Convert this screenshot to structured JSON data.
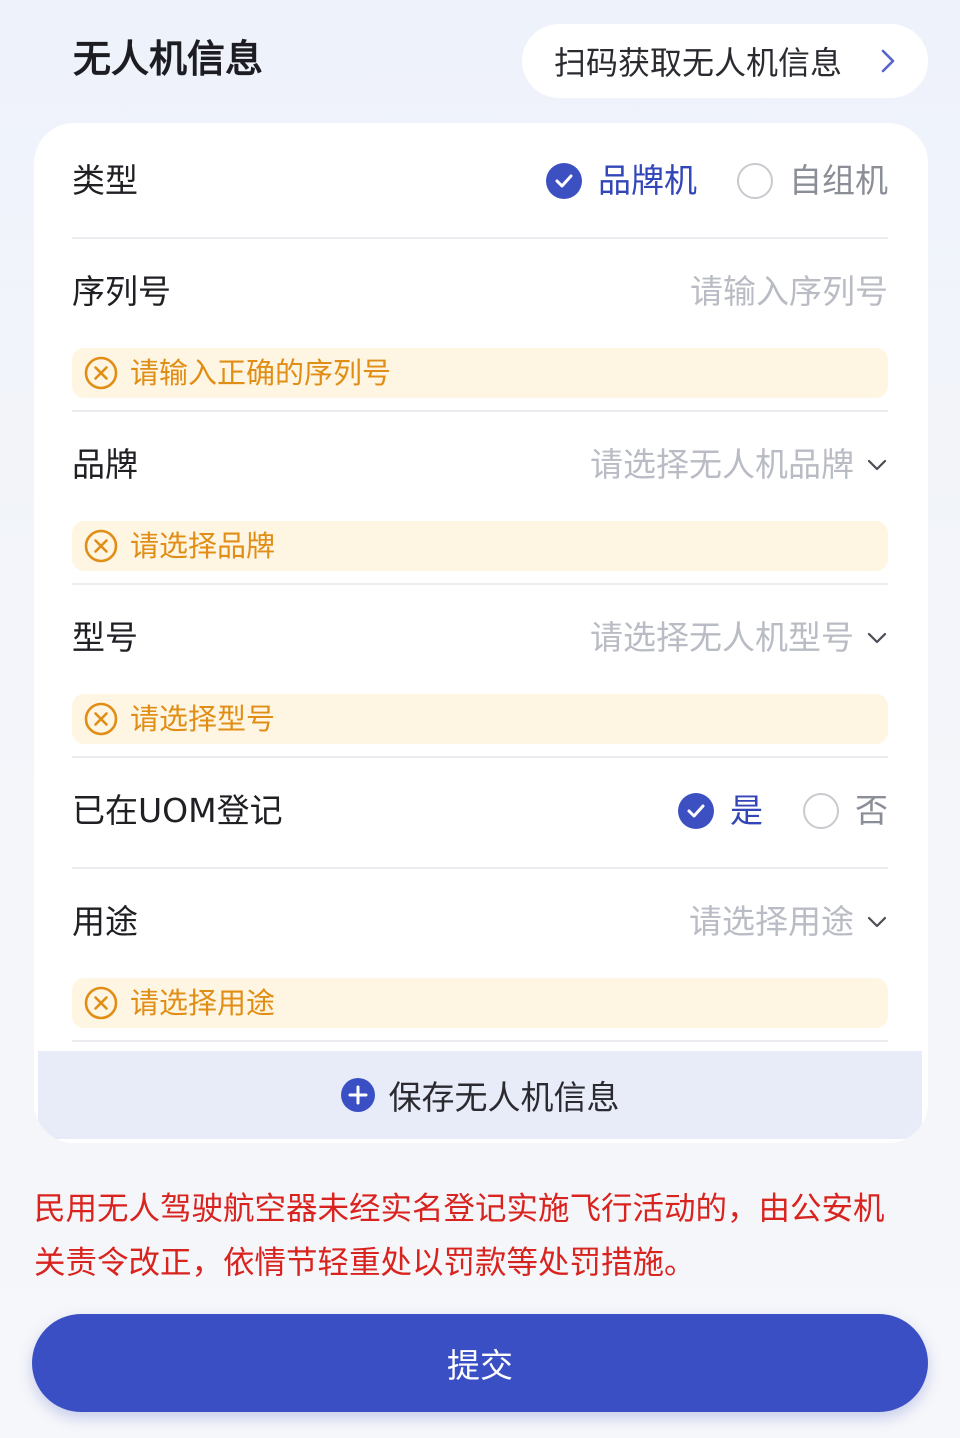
{
  "header": {
    "title": "无人机信息",
    "scan_button": "扫码获取无人机信息"
  },
  "form": {
    "type": {
      "label": "类型",
      "options": [
        "品牌机",
        "自组机"
      ],
      "selected": "品牌机"
    },
    "serial": {
      "label": "序列号",
      "placeholder": "请输入序列号",
      "error": "请输入正确的序列号"
    },
    "brand": {
      "label": "品牌",
      "placeholder": "请选择无人机品牌",
      "error": "请选择品牌"
    },
    "model": {
      "label": "型号",
      "placeholder": "请选择无人机型号",
      "error": "请选择型号"
    },
    "uom": {
      "label": "已在UOM登记",
      "options": [
        "是",
        "否"
      ],
      "selected": "是"
    },
    "usage": {
      "label": "用途",
      "placeholder": "请选择用途",
      "error": "请选择用途"
    },
    "save_label": "保存无人机信息"
  },
  "warning": "民用无人驾驶航空器未经实名登记实施飞行活动的，由公安机关责令改正，依情节轻重处以罚款等处罚措施。",
  "submit_label": "提交",
  "colors": {
    "accent": "#3b4fc4",
    "error_text": "#e08e15",
    "error_bg": "#fff5e3",
    "warning_text": "#d9231f",
    "placeholder": "#b9bcc4"
  }
}
